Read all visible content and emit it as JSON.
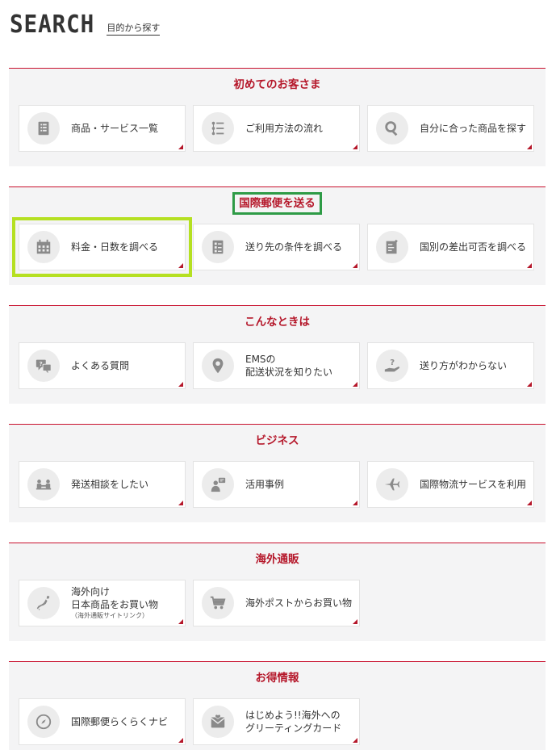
{
  "header": {
    "title": "SEARCH",
    "subtitle": "目的から探す"
  },
  "colors": {
    "accent": "#b5172a",
    "section_bg": "#f4f4f5",
    "highlight_green": "#2e9b46",
    "highlight_lime": "#b5e022"
  },
  "sections": [
    {
      "title": "初めてのお客さま",
      "items": [
        {
          "label": "商品・サービス一覧",
          "icon": "list-document-icon"
        },
        {
          "label": "ご利用方法の流れ",
          "icon": "steps-list-icon"
        },
        {
          "label": "自分に合った商品を探す",
          "icon": "search-icon"
        }
      ]
    },
    {
      "title": "国際郵便を送る",
      "items": [
        {
          "label": "料金・日数を調べる",
          "icon": "calendar-icon"
        },
        {
          "label": "送り先の条件を調べる",
          "icon": "checklist-icon"
        },
        {
          "label": "国別の差出可否を調べる",
          "icon": "document-edit-icon"
        }
      ]
    },
    {
      "title": "こんなときは",
      "items": [
        {
          "label_line1": "よくある質問",
          "icon": "faq-chat-icon"
        },
        {
          "label_line1": "EMSの",
          "label_line2": "配送状況を知りたい",
          "icon": "location-pin-icon"
        },
        {
          "label_line1": "送り方がわからない",
          "icon": "question-hand-icon"
        }
      ]
    },
    {
      "title": "ビジネス",
      "items": [
        {
          "label": "発送相談をしたい",
          "icon": "meeting-icon"
        },
        {
          "label": "活用事例",
          "icon": "presenter-icon"
        },
        {
          "label": "国際物流サービスを利用",
          "icon": "airplane-icon"
        }
      ]
    },
    {
      "title": "海外通販",
      "items": [
        {
          "label_line1": "海外向け",
          "label_line2": "日本商品をお買い物",
          "label_small": "（海外通販サイトリンク）",
          "icon": "japan-map-icon"
        },
        {
          "label_line1": "海外ポストからお買い物",
          "icon": "shopping-cart-icon"
        }
      ]
    },
    {
      "title": "お得情報",
      "items": [
        {
          "label_line1": "国際郵便らくらくナビ",
          "icon": "compass-icon"
        },
        {
          "label_line1": "はじめよう!!海外への",
          "label_line2": "グリーティングカード",
          "icon": "greeting-card-icon"
        }
      ]
    }
  ]
}
